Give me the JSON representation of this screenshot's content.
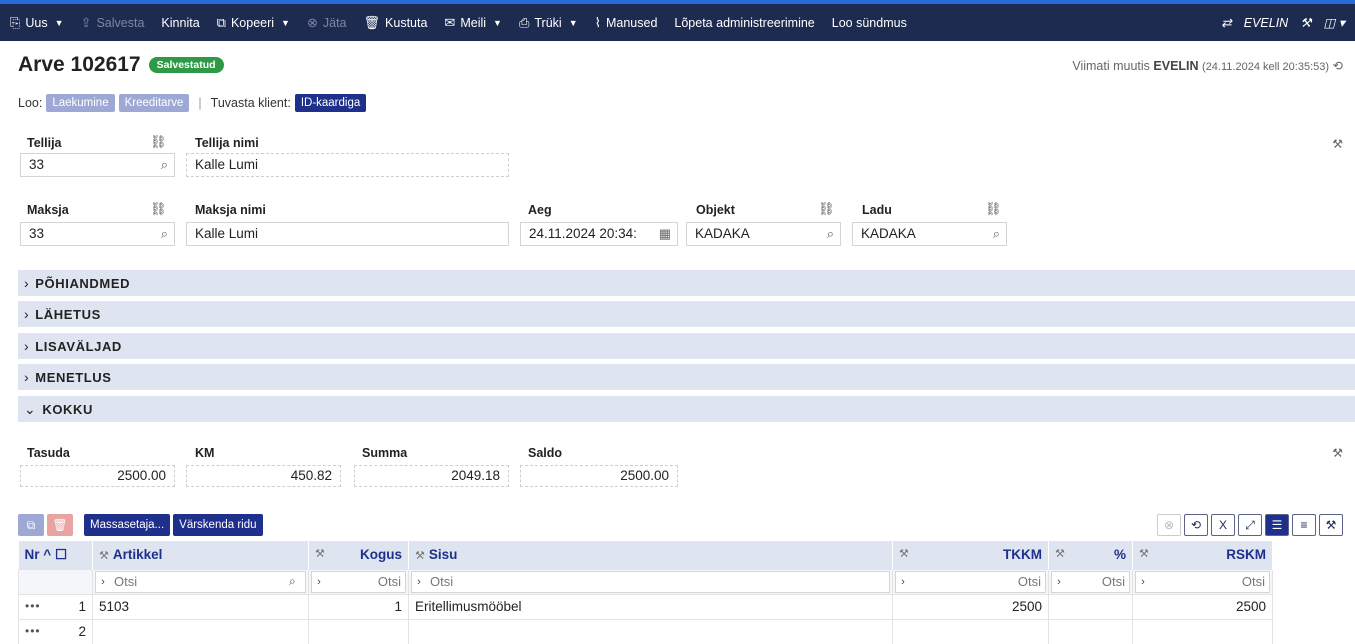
{
  "toolbar": {
    "new_label": "Uus",
    "save_label": "Salvesta",
    "confirm_label": "Kinnita",
    "copy_label": "Kopeeri",
    "drop_label": "Jäta",
    "delete_label": "Kustuta",
    "mail_label": "Meili",
    "print_label": "Trüki",
    "attachments_label": "Manused",
    "end_admin_label": "Lõpeta administreerimine",
    "create_event_label": "Loo sündmus",
    "user_label": "EVELIN"
  },
  "header": {
    "title": "Arve 102617",
    "status_badge": "Salvestatud",
    "modified_prefix": "Viimati muutis",
    "modified_user": "EVELIN",
    "modified_time": "(24.11.2024 kell 20:35:53)"
  },
  "create": {
    "label": "Loo:",
    "payment_btn": "Laekumine",
    "credit_btn": "Kreeditarve",
    "identify_label": "Tuvasta klient:",
    "idcard_btn": "ID-kaardiga"
  },
  "fields": {
    "orderer_label": "Tellija",
    "orderer_value": "33",
    "orderer_name_label": "Tellija nimi",
    "orderer_name_value": "Kalle Lumi",
    "payer_label": "Maksja",
    "payer_value": "33",
    "payer_name_label": "Maksja nimi",
    "payer_name_value": "Kalle Lumi",
    "time_label": "Aeg",
    "time_value": "24.11.2024 20:34:",
    "object_label": "Objekt",
    "object_value": "KADAKA",
    "warehouse_label": "Ladu",
    "warehouse_value": "KADAKA"
  },
  "sections": [
    "PÕHIANDMED",
    "LÄHETUS",
    "LISAVÄLJAD",
    "MENETLUS",
    "KOKKU"
  ],
  "totals": {
    "pay_label": "Tasuda",
    "pay_value": "2500.00",
    "vat_label": "KM",
    "vat_value": "450.82",
    "sum_label": "Summa",
    "sum_value": "2049.18",
    "balance_label": "Saldo",
    "balance_value": "2500.00"
  },
  "row_actions": {
    "mass_setter": "Massasetaja...",
    "refresh_rows": "Värskenda ridu"
  },
  "grid": {
    "headers": {
      "nr": "Nr",
      "article": "Artikkel",
      "qty": "Kogus",
      "content": "Sisu",
      "tkkm": "TKKM",
      "pct": "%",
      "rskm": "RSKM"
    },
    "filter_placeholder": "Otsi",
    "rows": [
      {
        "nr": "1",
        "article": "5103",
        "qty": "1",
        "content": "Eritellimusmööbel",
        "tkkm": "2500",
        "pct": "",
        "rskm": "2500"
      },
      {
        "nr": "2",
        "article": "",
        "qty": "",
        "content": "",
        "tkkm": "",
        "pct": "",
        "rskm": ""
      }
    ]
  }
}
